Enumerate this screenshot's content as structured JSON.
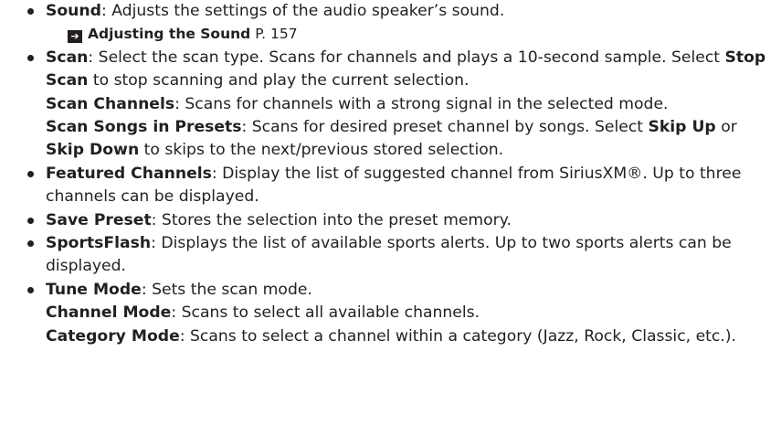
{
  "items": [
    {
      "term": "Sound",
      "desc": ": Adjusts the settings of the audio speaker’s sound.",
      "xref": {
        "title": "Adjusting the Sound",
        "page": "P. 157"
      }
    },
    {
      "term": "Scan",
      "desc": ": Select the scan type. Scans for channels and plays a 10-second sample. Select ",
      "desc_b": "Stop Scan",
      "desc_c": " to stop scanning and play the current selection.",
      "sub1": {
        "term": "Scan Channels",
        "desc": ": Scans for channels with a strong signal in the selected mode."
      },
      "sub2": {
        "term": "Scan Songs in Presets",
        "desc": ": Scans for desired preset channel by songs. Select ",
        "b1": "Skip Up",
        "mid": " or ",
        "b2": "Skip Down",
        "end": " to skips to the next/previous stored selection."
      }
    },
    {
      "term": "Featured Channels",
      "desc": ": Display the list of suggested channel from SiriusXM®. Up to three channels can be displayed."
    },
    {
      "term": "Save Preset",
      "desc": ": Stores the selection into the preset memory."
    },
    {
      "term": "SportsFlash",
      "desc": ": Displays the list of available sports alerts. Up to two sports alerts can be displayed."
    },
    {
      "term": "Tune Mode",
      "desc": ": Sets the scan mode.",
      "sub1": {
        "term": "Channel Mode",
        "desc": ": Scans to select all available channels."
      },
      "sub2": {
        "term": "Category Mode",
        "desc": ": Scans to select a channel within a category (Jazz, Rock, Classic, etc.)."
      }
    }
  ]
}
